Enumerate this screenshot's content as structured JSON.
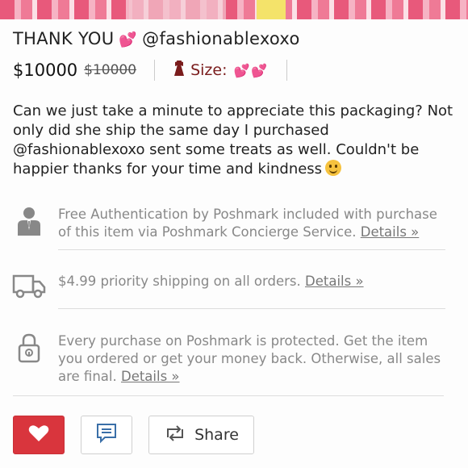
{
  "listing": {
    "title_prefix": "THANK YOU",
    "title_handle": "@fashionablexoxo",
    "price": "$10000",
    "original_price": "$10000",
    "size_label": "Size:",
    "description_main": "Can we just take a minute to appreciate this packaging? Not only did she ship the same day I purchased @fashionablexoxo sent some treats as well. Couldn't be happier thanks for your time and kindness"
  },
  "info": {
    "auth_text": "Free Authentication by Poshmark included with purchase of this item via Poshmark Concierge Service.",
    "auth_link": "Details »",
    "shipping_text": "$4.99 priority shipping on all orders.",
    "shipping_link": "Details »",
    "protect_text": "Every purchase on Poshmark is protected. Get the item you ordered or get your money back. Otherwise, all sales are final.",
    "protect_link": "Details »"
  },
  "actions": {
    "share_label": "Share"
  },
  "colors": {
    "like_button": "#d9353d",
    "size_text": "#7a1c1c",
    "emoji_heart": "#e8457d",
    "muted_text": "#888888"
  },
  "icons": {
    "title_heart": "two-hearts-icon",
    "size_dress": "dress-icon",
    "auth": "concierge-person-icon",
    "shipping": "truck-icon",
    "protect": "lock-icon",
    "like": "heart-icon",
    "comment": "comment-icon",
    "share": "share-arrows-icon",
    "smile": "smiley-face-icon"
  }
}
